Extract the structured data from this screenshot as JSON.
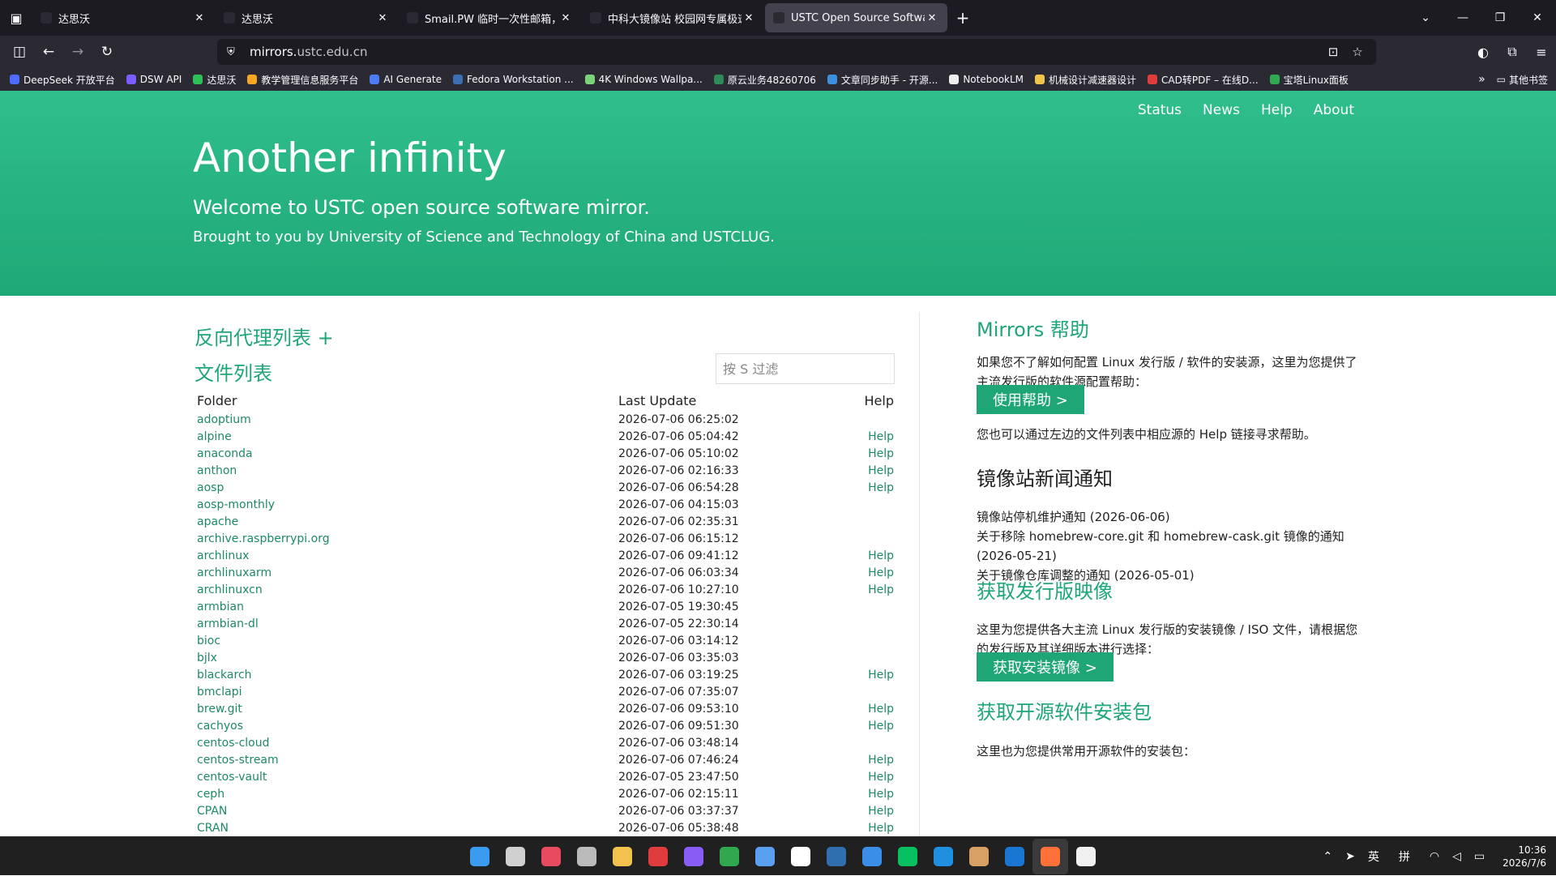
{
  "browser": {
    "tabs": [
      {
        "title": "达思沃",
        "active": false
      },
      {
        "title": "达思沃",
        "active": false
      },
      {
        "title": "Smail.PW 临时一次性邮箱，注",
        "active": false
      },
      {
        "title": "中科大镜像站 校园网专属极速",
        "active": false
      },
      {
        "title": "USTC Open Source Software",
        "active": true
      }
    ],
    "new_tab": "+",
    "url_host": "mirrors.",
    "url_domain": "ustc.edu.cn",
    "bookmarks": [
      "DeepSeek 开放平台",
      "DSW API",
      "达思沃",
      "教学管理信息服务平台",
      "AI Generate",
      "Fedora Workstation ...",
      "4K Windows Wallpa...",
      "原云业务48260706",
      "文章同步助手 - 开源...",
      "NotebookLM",
      "机械设计减速器设计",
      "CAD转PDF – 在线D...",
      "宝塔Linux面板"
    ],
    "other_bookmarks": "其他书签",
    "bookmark_colors": [
      "#4d6bfe",
      "#7c5cff",
      "#2fbf58",
      "#f5a623",
      "#4c7cf3",
      "#3c6eb4",
      "#7cd17b",
      "#2e8b57",
      "#3d8fe0",
      "#eeeeee",
      "#f3c44b",
      "#e03c3c",
      "#2fa84f"
    ]
  },
  "site": {
    "nav": [
      "Status",
      "News",
      "Help",
      "About"
    ],
    "title": "Another infinity",
    "subtitle": "Welcome to USTC open source software mirror.",
    "tagline": "Brought to you by University of Science and Technology of China and USTCLUG.",
    "proxy_title": "反向代理列表 +",
    "files_title": "文件列表",
    "filter_placeholder": "按 S 过滤",
    "columns": {
      "folder": "Folder",
      "last_update": "Last Update",
      "help": "Help"
    },
    "rows": [
      {
        "name": "adoptium",
        "date": "2026-07-06 06:25:02",
        "help": ""
      },
      {
        "name": "alpine",
        "date": "2026-07-06 05:04:42",
        "help": "Help"
      },
      {
        "name": "anaconda",
        "date": "2026-07-06 05:10:02",
        "help": "Help"
      },
      {
        "name": "anthon",
        "date": "2026-07-06 02:16:33",
        "help": "Help"
      },
      {
        "name": "aosp",
        "date": "2026-07-06 06:54:28",
        "help": "Help"
      },
      {
        "name": "aosp-monthly",
        "date": "2026-07-06 04:15:03",
        "help": ""
      },
      {
        "name": "apache",
        "date": "2026-07-06 02:35:31",
        "help": ""
      },
      {
        "name": "archive.raspberrypi.org",
        "date": "2026-07-06 06:15:12",
        "help": ""
      },
      {
        "name": "archlinux",
        "date": "2026-07-06 09:41:12",
        "help": "Help"
      },
      {
        "name": "archlinuxarm",
        "date": "2026-07-06 06:03:34",
        "help": "Help"
      },
      {
        "name": "archlinuxcn",
        "date": "2026-07-06 10:27:10",
        "help": "Help"
      },
      {
        "name": "armbian",
        "date": "2026-07-05 19:30:45",
        "help": ""
      },
      {
        "name": "armbian-dl",
        "date": "2026-07-05 22:30:14",
        "help": ""
      },
      {
        "name": "bioc",
        "date": "2026-07-06 03:14:12",
        "help": ""
      },
      {
        "name": "bjlx",
        "date": "2026-07-06 03:35:03",
        "help": ""
      },
      {
        "name": "blackarch",
        "date": "2026-07-06 03:19:25",
        "help": "Help"
      },
      {
        "name": "bmclapi",
        "date": "2026-07-06 07:35:07",
        "help": ""
      },
      {
        "name": "brew.git",
        "date": "2026-07-06 09:53:10",
        "help": "Help"
      },
      {
        "name": "cachyos",
        "date": "2026-07-06 09:51:30",
        "help": "Help"
      },
      {
        "name": "centos-cloud",
        "date": "2026-07-06 03:48:14",
        "help": ""
      },
      {
        "name": "centos-stream",
        "date": "2026-07-06 07:46:24",
        "help": "Help"
      },
      {
        "name": "centos-vault",
        "date": "2026-07-05 23:47:50",
        "help": "Help"
      },
      {
        "name": "ceph",
        "date": "2026-07-06 02:15:11",
        "help": "Help"
      },
      {
        "name": "CPAN",
        "date": "2026-07-06 03:37:37",
        "help": "Help"
      },
      {
        "name": "CRAN",
        "date": "2026-07-06 05:38:48",
        "help": "Help"
      }
    ],
    "help_section": {
      "title": "Mirrors 帮助",
      "text": "如果您不了解如何配置 Linux 发行版 / 软件的安装源，这里为您提供了主流发行版的软件源配置帮助：",
      "button": "使用帮助 >",
      "text2": "您也可以通过左边的文件列表中相应源的 Help 链接寻求帮助。"
    },
    "news_section": {
      "title": "镜像站新闻通知",
      "items": [
        "镜像站停机维护通知 (2026-06-06)",
        "关于移除 homebrew-core.git 和 homebrew-cask.git 镜像的通知 (2026-05-21)",
        "关于镜像仓库调整的通知 (2026-05-01)"
      ]
    },
    "iso_section": {
      "title": "获取发行版映像",
      "text": "这里为您提供各大主流 Linux 发行版的安装镜像 / ISO 文件，请根据您的发行版及其详细版本进行选择：",
      "button": "获取安装镜像 >"
    },
    "pkg_section": {
      "title": "获取开源软件安装包",
      "text": "这里也为您提供常用开源软件的安装包："
    }
  },
  "taskbar": {
    "app_colors": [
      "#3a9bf0",
      "#d0d0d0",
      "#e84a5f",
      "#bbbbbb",
      "#f2c14e",
      "#e03c3c",
      "#8a5cf6",
      "#2fa84f",
      "#5aa0f0",
      "#ffffff",
      "#2f6fb0",
      "#3a8ee6",
      "#07c160",
      "#1f8fe0",
      "#d9a066",
      "#1976d2",
      "#ff7139",
      "#f0f0f0"
    ],
    "ime1": "英",
    "ime2": "拼",
    "time": "10:36",
    "date": "2026/7/6"
  }
}
